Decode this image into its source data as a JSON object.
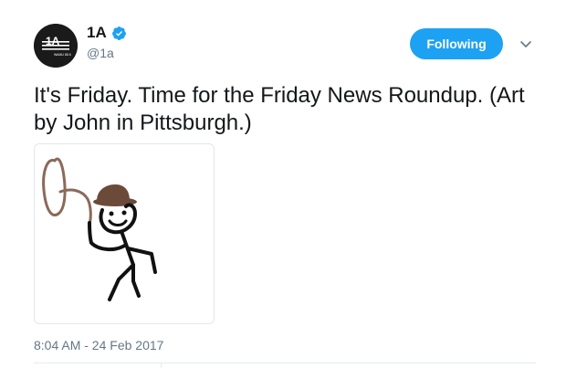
{
  "author": {
    "display_name": "1A",
    "handle": "@1a",
    "avatar_text": "1A",
    "avatar_subtext": "WAMU 88.5",
    "verified": true
  },
  "actions": {
    "follow_label": "Following"
  },
  "tweet": {
    "text": "It's Friday. Time for the Friday News Roundup. (Art by John in Pittsburgh.)",
    "timestamp": "8:04 AM - 24 Feb 2017",
    "media_description": "stick-figure-cowboy-with-lasso"
  },
  "colors": {
    "accent": "#1da1f2",
    "text": "#14171a",
    "muted": "#657786",
    "hat": "#6b4a3a",
    "lasso": "#8a6a5a"
  },
  "icons": {
    "verified": "verified-badge-icon",
    "caret": "chevron-down-icon"
  }
}
